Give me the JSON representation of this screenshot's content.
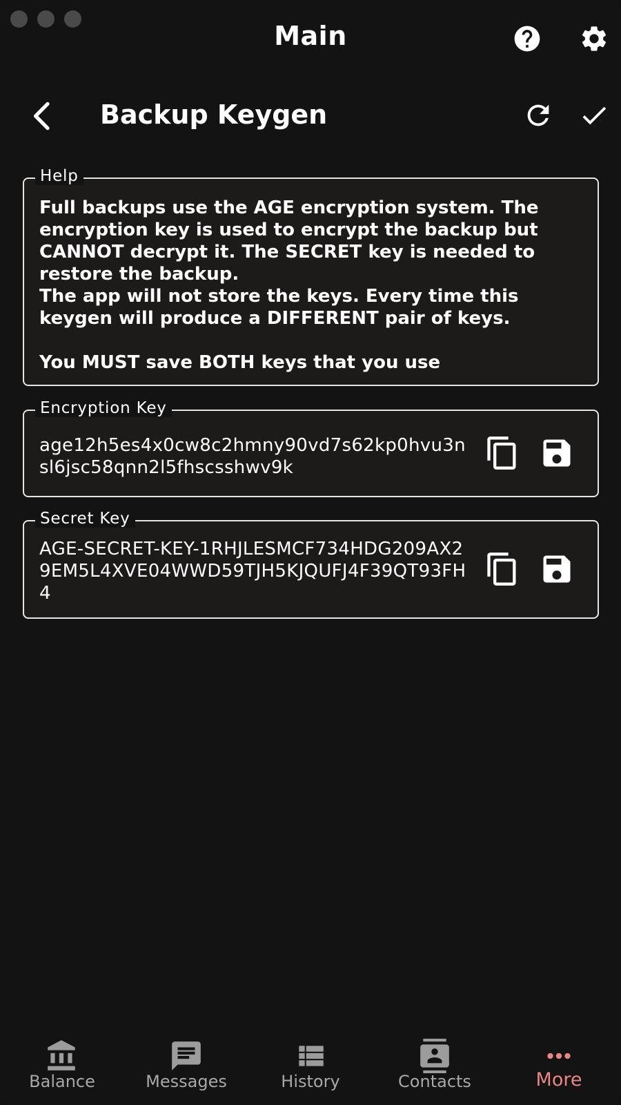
{
  "window": {
    "title": "Main"
  },
  "page": {
    "title": "Backup Keygen"
  },
  "help": {
    "legend": "Help",
    "text": "Full backups use the AGE encryption system. The encryption key is used to encrypt the backup but CANNOT decrypt it. The SECRET key is needed to restore the backup.\nThe app will not store the keys. Every time this keygen will produce a DIFFERENT pair of keys.\n\nYou MUST save BOTH keys that you use"
  },
  "encryption_key": {
    "legend": "Encryption Key",
    "value": "age12h5es4x0cw8c2hmny90vd7s62kp0hvu3nsl6jsc58qnn2l5fhscsshwv9k"
  },
  "secret_key": {
    "legend": "Secret Key",
    "value": "AGE-SECRET-KEY-1RHJLESMCF734HDG209AX29EM5L4XVE04WWD59TJH5KJQUFJ4F39QT93FH4"
  },
  "nav": {
    "items": [
      {
        "label": "Balance",
        "icon": "bank-icon"
      },
      {
        "label": "Messages",
        "icon": "message-icon"
      },
      {
        "label": "History",
        "icon": "list-icon"
      },
      {
        "label": "Contacts",
        "icon": "contacts-icon"
      },
      {
        "label": "More",
        "icon": "more-horizontal-icon"
      }
    ],
    "active": "More",
    "active_color": "#e98686"
  }
}
